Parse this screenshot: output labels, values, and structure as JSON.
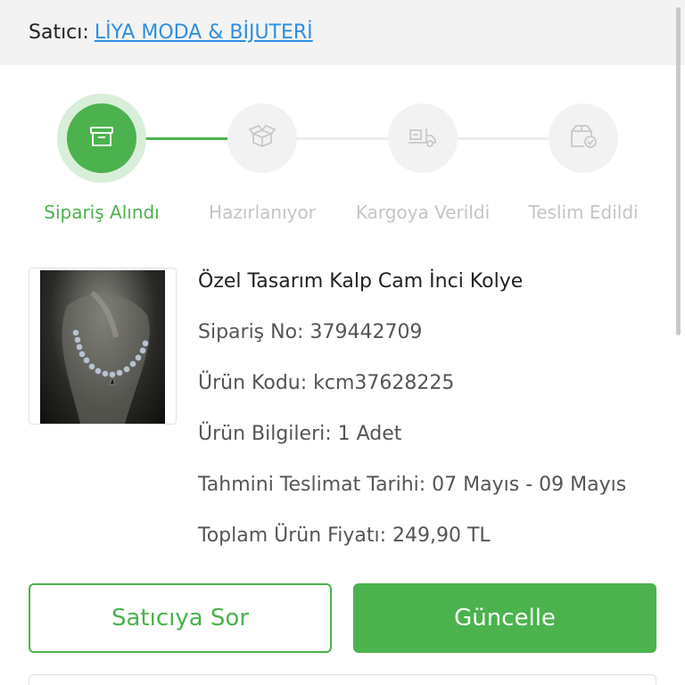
{
  "seller": {
    "label": "Satıcı:",
    "name": "LİYA MODA & BİJUTERİ"
  },
  "tracker": {
    "steps": [
      {
        "label": "Sipariş Alındı",
        "icon": "archive-box-icon",
        "active": true
      },
      {
        "label": "Hazırlanıyor",
        "icon": "open-box-icon",
        "active": false
      },
      {
        "label": "Kargoya Verildi",
        "icon": "cargo-truck-icon",
        "active": false
      },
      {
        "label": "Teslim Edildi",
        "icon": "delivered-box-icon",
        "active": false
      }
    ]
  },
  "product": {
    "title": "Özel Tasarım Kalp Cam İnci Kolye",
    "order_no": "Sipariş No: 379442709",
    "product_code": "Ürün Kodu: kcm37628225",
    "info": "Ürün Bilgileri: 1 Adet",
    "delivery": "Tahmini Teslimat Tarihi: 07 Mayıs - 09 Mayıs",
    "price": "Toplam Ürün Fiyatı: 249,90 TL"
  },
  "actions": {
    "ask_seller": "Satıcıya Sor",
    "update": "Güncelle"
  },
  "colors": {
    "accent": "#4bb24e",
    "link": "#2e8fe0",
    "inactive": "#c5c5c5"
  }
}
